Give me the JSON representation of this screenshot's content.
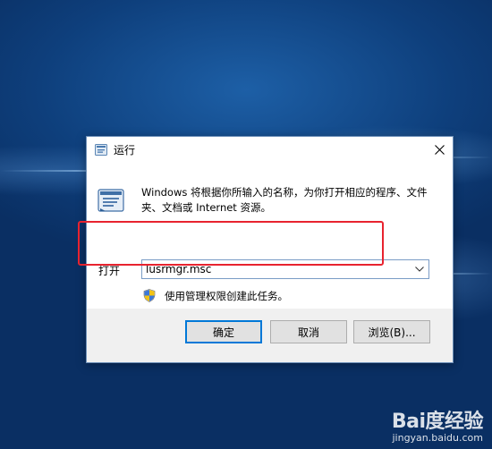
{
  "dialog": {
    "title": "运行",
    "description": "Windows 将根据你所输入的名称，为你打开相应的程序、文件夹、文档或 Internet 资源。",
    "open_label": "打开",
    "open_value": "lusrmgr.msc",
    "admin_note": "使用管理权限创建此任务。",
    "ok_label": "确定",
    "cancel_label": "取消",
    "browse_label": "浏览(B)...",
    "icons": {
      "title": "run-app-icon",
      "main": "run-dialog-icon",
      "shield": "uac-shield-icon",
      "close": "close-icon",
      "dropdown": "chevron-down-icon"
    },
    "highlight_color": "#e8232f",
    "accent_color": "#0078d7"
  },
  "watermark": {
    "logo": "Bai度经验",
    "url": "jingyan.baidu.com"
  }
}
